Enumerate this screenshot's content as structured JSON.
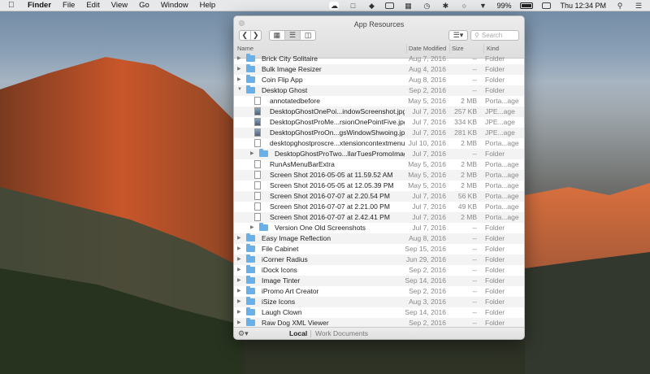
{
  "menubar": {
    "app_name": "Finder",
    "menus": [
      "File",
      "Edit",
      "View",
      "Go",
      "Window",
      "Help"
    ],
    "battery_text": "99%",
    "clock_text": "Thu 12:34 PM"
  },
  "window": {
    "title": "App Resources",
    "search_placeholder": "Search",
    "columns": {
      "name": "Name",
      "date": "Date Modified",
      "size": "Size",
      "kind": "Kind"
    },
    "rows": [
      {
        "indent": 0,
        "type": "folder",
        "expand": "closed",
        "name": "Brick City Solitaire",
        "date": "Aug 7, 2016",
        "size": "--",
        "kind": "Folder"
      },
      {
        "indent": 0,
        "type": "folder",
        "expand": "closed",
        "name": "Bulk Image Resizer",
        "date": "Aug 4, 2016",
        "size": "--",
        "kind": "Folder"
      },
      {
        "indent": 0,
        "type": "folder",
        "expand": "closed",
        "name": "Coin Flip App",
        "date": "Aug 8, 2016",
        "size": "--",
        "kind": "Folder"
      },
      {
        "indent": 0,
        "type": "folder",
        "expand": "open",
        "name": "Desktop Ghost",
        "date": "Sep 2, 2016",
        "size": "--",
        "kind": "Folder"
      },
      {
        "indent": 1,
        "type": "file",
        "expand": "",
        "name": "annotatedbefore",
        "date": "May 5, 2016",
        "size": "2 MB",
        "kind": "Porta...age"
      },
      {
        "indent": 1,
        "type": "image",
        "expand": "",
        "name": "DesktopGhostOnePoi...indowScreenshot.jpg",
        "date": "Jul 7, 2016",
        "size": "257 KB",
        "kind": "JPE...age"
      },
      {
        "indent": 1,
        "type": "image",
        "expand": "",
        "name": "DesktopGhostProMe...rsionOnePointFive.jpg",
        "date": "Jul 7, 2016",
        "size": "334 KB",
        "kind": "JPE...age"
      },
      {
        "indent": 1,
        "type": "image",
        "expand": "",
        "name": "DesktopGhostProOn...gsWindowShwoing.jpg",
        "date": "Jul 7, 2016",
        "size": "281 KB",
        "kind": "JPE...age"
      },
      {
        "indent": 1,
        "type": "file",
        "expand": "",
        "name": "desktopghostproscre...xtensioncontextmenu",
        "date": "Jul 10, 2016",
        "size": "2 MB",
        "kind": "Porta...age"
      },
      {
        "indent": 1,
        "type": "folder",
        "expand": "closed",
        "name": "DesktopGhostProTwo...llarTuesPromoImages",
        "date": "Jul 7, 2016",
        "size": "--",
        "kind": "Folder"
      },
      {
        "indent": 1,
        "type": "file",
        "expand": "",
        "name": "RunAsMenuBarExtra",
        "date": "May 5, 2016",
        "size": "2 MB",
        "kind": "Porta...age"
      },
      {
        "indent": 1,
        "type": "file",
        "expand": "",
        "name": "Screen Shot 2016-05-05 at 11.59.52 AM",
        "date": "May 5, 2016",
        "size": "2 MB",
        "kind": "Porta...age"
      },
      {
        "indent": 1,
        "type": "file",
        "expand": "",
        "name": "Screen Shot 2016-05-05 at 12.05.39 PM",
        "date": "May 5, 2016",
        "size": "2 MB",
        "kind": "Porta...age"
      },
      {
        "indent": 1,
        "type": "file",
        "expand": "",
        "name": "Screen Shot 2016-07-07 at 2.20.54 PM",
        "date": "Jul 7, 2016",
        "size": "56 KB",
        "kind": "Porta...age"
      },
      {
        "indent": 1,
        "type": "file",
        "expand": "",
        "name": "Screen Shot 2016-07-07 at 2.21.00 PM",
        "date": "Jul 7, 2016",
        "size": "49 KB",
        "kind": "Porta...age"
      },
      {
        "indent": 1,
        "type": "file",
        "expand": "",
        "name": "Screen Shot 2016-07-07 at 2.42.41 PM",
        "date": "Jul 7, 2016",
        "size": "2 MB",
        "kind": "Porta...age"
      },
      {
        "indent": 1,
        "type": "folder",
        "expand": "closed",
        "name": "Version One Old Screenshots",
        "date": "Jul 7, 2016",
        "size": "--",
        "kind": "Folder"
      },
      {
        "indent": 0,
        "type": "folder",
        "expand": "closed",
        "name": "Easy Image Reflection",
        "date": "Aug 8, 2016",
        "size": "--",
        "kind": "Folder"
      },
      {
        "indent": 0,
        "type": "folder",
        "expand": "closed",
        "name": "File Cabinet",
        "date": "Sep 15, 2016",
        "size": "--",
        "kind": "Folder"
      },
      {
        "indent": 0,
        "type": "folder",
        "expand": "closed",
        "name": "iCorner Radius",
        "date": "Jun 29, 2016",
        "size": "--",
        "kind": "Folder"
      },
      {
        "indent": 0,
        "type": "folder",
        "expand": "closed",
        "name": "iDock Icons",
        "date": "Sep 2, 2016",
        "size": "--",
        "kind": "Folder"
      },
      {
        "indent": 0,
        "type": "folder",
        "expand": "closed",
        "name": "Image Tinter",
        "date": "Sep 14, 2016",
        "size": "--",
        "kind": "Folder"
      },
      {
        "indent": 0,
        "type": "folder",
        "expand": "closed",
        "name": "iPromo Art Creator",
        "date": "Sep 2, 2016",
        "size": "--",
        "kind": "Folder"
      },
      {
        "indent": 0,
        "type": "folder",
        "expand": "closed",
        "name": "iSize Icons",
        "date": "Aug 3, 2016",
        "size": "--",
        "kind": "Folder"
      },
      {
        "indent": 0,
        "type": "folder",
        "expand": "closed",
        "name": "Laugh Clown",
        "date": "Sep 14, 2016",
        "size": "--",
        "kind": "Folder"
      },
      {
        "indent": 0,
        "type": "folder",
        "expand": "closed",
        "name": "Raw Dog XML Viewer",
        "date": "Sep 2, 2016",
        "size": "--",
        "kind": "Folder"
      }
    ],
    "bottom": {
      "local_label": "Local",
      "work_label": "Work Documents"
    }
  }
}
